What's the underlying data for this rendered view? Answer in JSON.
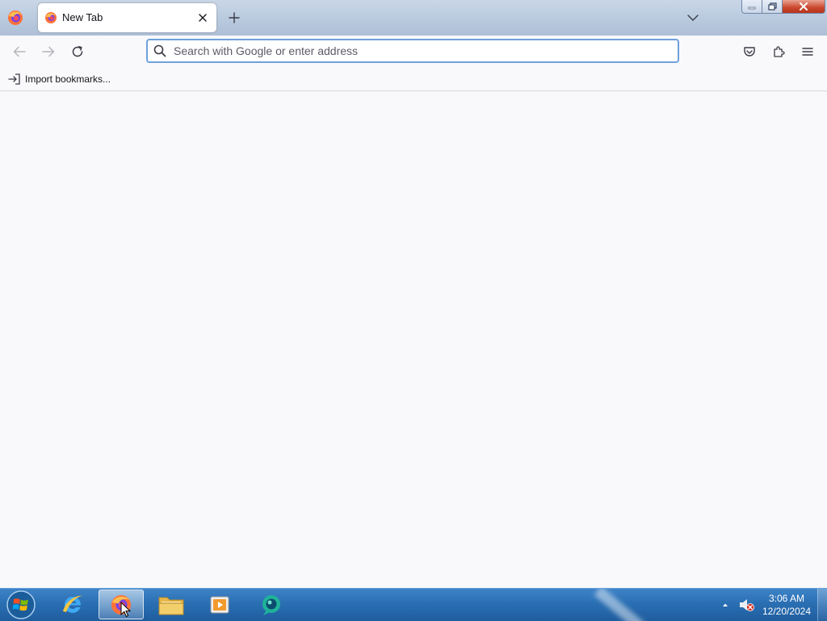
{
  "browser": {
    "tabs": [
      {
        "title": "New Tab",
        "active": true
      }
    ],
    "urlbar": {
      "value": "",
      "placeholder": "Search with Google or enter address"
    },
    "bookmarks": {
      "items": [
        {
          "label": "Import bookmarks...",
          "icon": "import-icon"
        }
      ]
    },
    "toolbar_icons": [
      "back-arrow-icon",
      "forward-arrow-icon",
      "reload-icon",
      "pocket-icon",
      "extensions-icon",
      "hamburger-menu-icon"
    ]
  },
  "taskbar": {
    "apps": [
      {
        "name": "Internet Explorer",
        "icon": "ie-icon",
        "active": false
      },
      {
        "name": "Firefox",
        "icon": "firefox-icon",
        "active": true
      },
      {
        "name": "Windows Explorer",
        "icon": "folder-icon",
        "active": false
      },
      {
        "name": "Media Player",
        "icon": "media-player-icon",
        "active": false
      },
      {
        "name": "Chat",
        "icon": "chat-icon",
        "active": false
      }
    ],
    "clock": {
      "time": "3:06 AM",
      "date": "12/20/2024"
    }
  },
  "colors": {
    "urlbar_focus": "#6fa0dc",
    "taskbar": "#2a6fb3",
    "close_button": "#c9462c",
    "page_background": "#f9f9fb"
  }
}
